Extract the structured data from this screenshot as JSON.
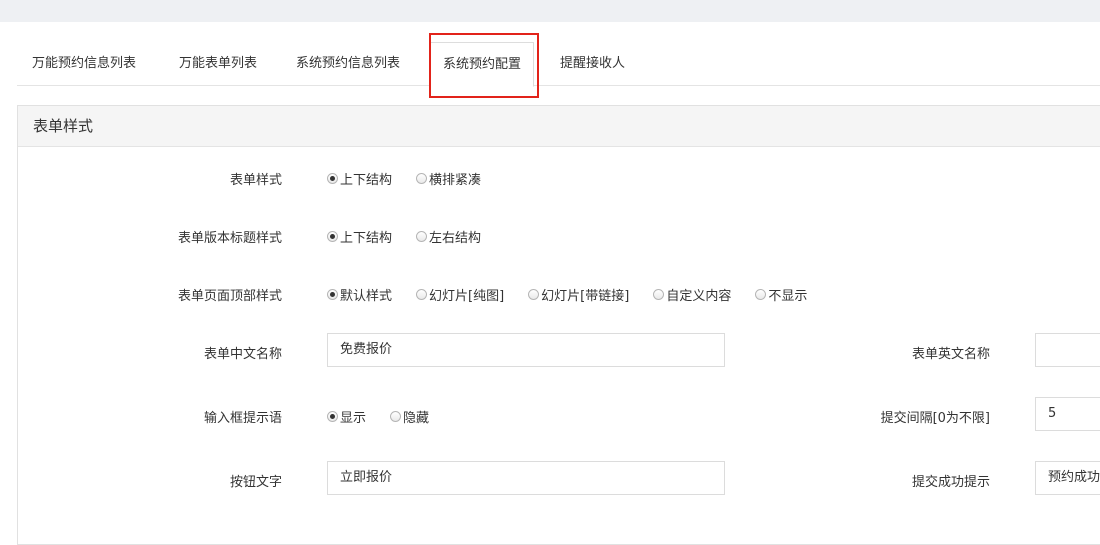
{
  "tabs": [
    {
      "label": "万能预约信息列表"
    },
    {
      "label": "万能表单列表"
    },
    {
      "label": "系统预约信息列表"
    },
    {
      "label": "系统预约配置",
      "active": true
    },
    {
      "label": "提醒接收人"
    }
  ],
  "colors": {
    "highlight_border": "#e2231a",
    "topbar_bg": "#eef0f3",
    "panel_header_bg": "#f5f5f5"
  },
  "panel": {
    "title": "表单样式"
  },
  "form": {
    "form_style": {
      "label": "表单样式",
      "options": [
        "上下结构",
        "横排紧凑"
      ],
      "selected": "上下结构"
    },
    "title_style": {
      "label": "表单版本标题样式",
      "options": [
        "上下结构",
        "左右结构"
      ],
      "selected": "上下结构"
    },
    "header_style": {
      "label": "表单页面顶部样式",
      "options": [
        "默认样式",
        "幻灯片[纯图]",
        "幻灯片[带链接]",
        "自定义内容",
        "不显示"
      ],
      "selected": "默认样式"
    },
    "cn_name": {
      "label": "表单中文名称",
      "value": "免费报价"
    },
    "en_name": {
      "label": "表单英文名称",
      "value": ""
    },
    "input_hint": {
      "label": "输入框提示语",
      "options": [
        "显示",
        "隐藏"
      ],
      "selected": "显示"
    },
    "interval": {
      "label": "提交间隔[0为不限]",
      "value": "5"
    },
    "button_text": {
      "label": "按钮文字",
      "value": "立即报价"
    },
    "success_tip": {
      "label": "提交成功提示",
      "value": "预约成功"
    }
  }
}
